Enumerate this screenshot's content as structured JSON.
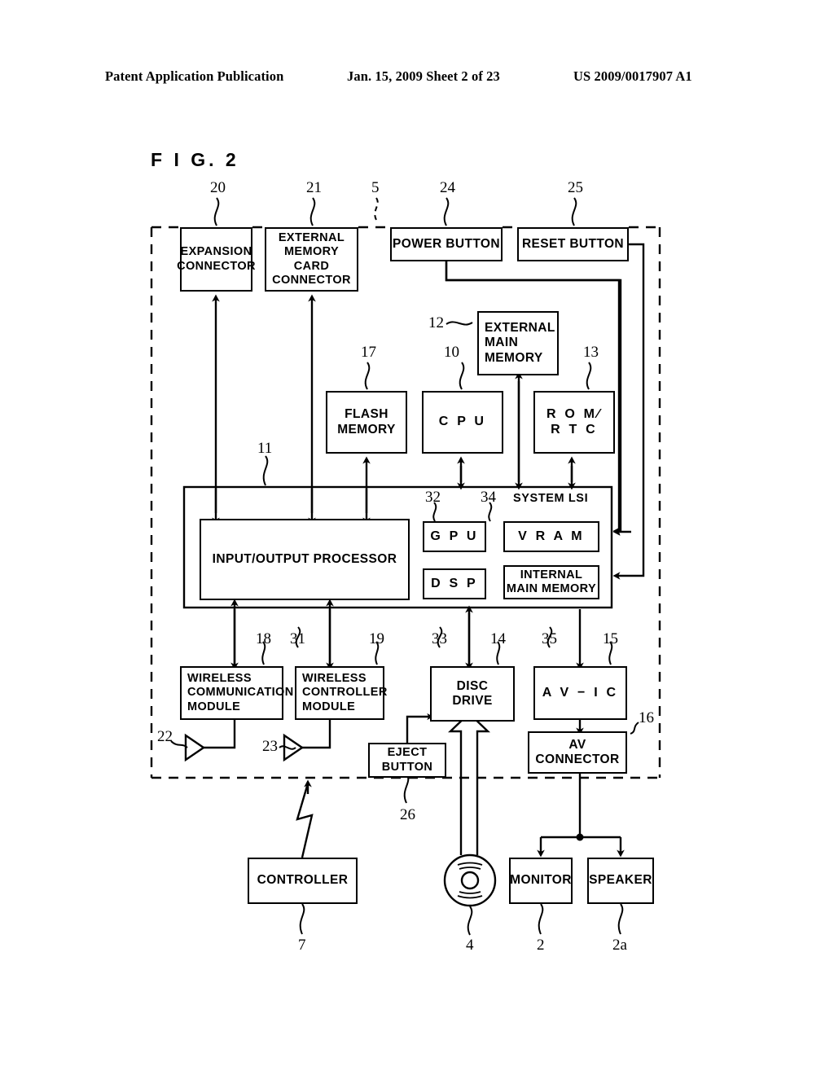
{
  "header": {
    "publication": "Patent Application Publication",
    "date_sheet": "Jan. 15, 2009  Sheet 2 of 23",
    "patent_number": "US 2009/0017907 A1"
  },
  "figure": {
    "label": "F I G.  2",
    "system_lsi_caption": "SYSTEM LSI"
  },
  "blocks": {
    "expansion_connector": "EXPANSION\nCONNECTOR",
    "external_memory_card_connector": "EXTERNAL\nMEMORY CARD\nCONNECTOR",
    "power_button": "POWER BUTTON",
    "reset_button": "RESET BUTTON",
    "external_main_memory": "EXTERNAL\nMAIN\nMEMORY",
    "flash_memory": "FLASH\nMEMORY",
    "cpu": "C P U",
    "rom_rtc": "R O M∕\nR T C",
    "input_output_processor": "INPUT/OUTPUT PROCESSOR",
    "gpu": "G P U",
    "vram": "V R A M",
    "dsp": "D S P",
    "internal_main_memory": "INTERNAL\nMAIN MEMORY",
    "wireless_communication_module": "WIRELESS\nCOMMUNICATION\nMODULE",
    "wireless_controller_module": "WIRELESS\nCONTROLLER\nMODULE",
    "disc_drive": "DISC\nDRIVE",
    "eject_button": "EJECT\nBUTTON",
    "av_ic": "A V − I C",
    "av_connector": "AV CONNECTOR",
    "controller": "CONTROLLER",
    "monitor": "MONITOR",
    "speaker": "SPEAKER"
  },
  "refs": [
    {
      "id": "ref-20",
      "text": "20"
    },
    {
      "id": "ref-21",
      "text": "21"
    },
    {
      "id": "ref-5",
      "text": "5"
    },
    {
      "id": "ref-24",
      "text": "24"
    },
    {
      "id": "ref-25",
      "text": "25"
    },
    {
      "id": "ref-12",
      "text": "12"
    },
    {
      "id": "ref-17",
      "text": "17"
    },
    {
      "id": "ref-10",
      "text": "10"
    },
    {
      "id": "ref-13",
      "text": "13"
    },
    {
      "id": "ref-11",
      "text": "11"
    },
    {
      "id": "ref-32",
      "text": "32"
    },
    {
      "id": "ref-34",
      "text": "34"
    },
    {
      "id": "ref-18",
      "text": "18"
    },
    {
      "id": "ref-31",
      "text": "31"
    },
    {
      "id": "ref-19",
      "text": "19"
    },
    {
      "id": "ref-33",
      "text": "33"
    },
    {
      "id": "ref-14",
      "text": "14"
    },
    {
      "id": "ref-35",
      "text": "35"
    },
    {
      "id": "ref-15",
      "text": "15"
    },
    {
      "id": "ref-16",
      "text": "16"
    },
    {
      "id": "ref-22",
      "text": "22"
    },
    {
      "id": "ref-23",
      "text": "23"
    },
    {
      "id": "ref-26",
      "text": "26"
    },
    {
      "id": "ref-7",
      "text": "7"
    },
    {
      "id": "ref-4",
      "text": "4"
    },
    {
      "id": "ref-2",
      "text": "2"
    },
    {
      "id": "ref-2a",
      "text": "2a"
    }
  ]
}
